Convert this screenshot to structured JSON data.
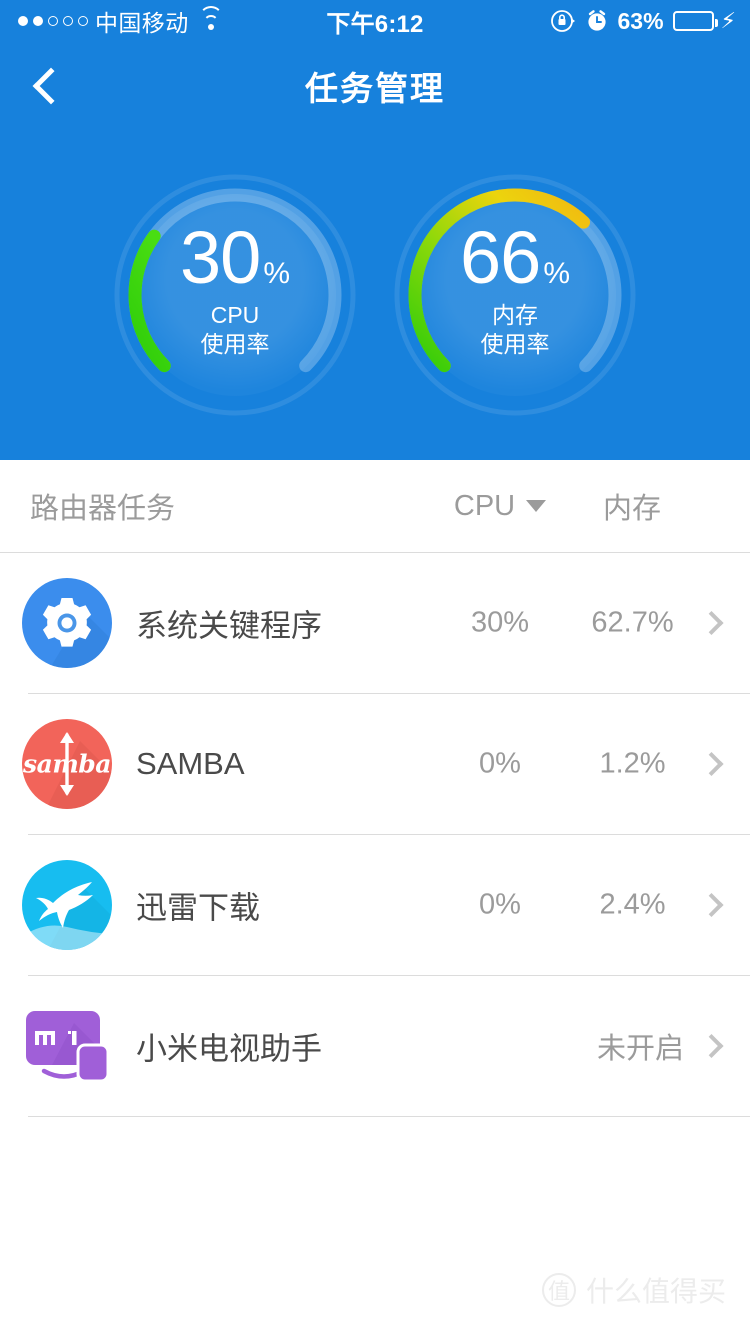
{
  "statusbar": {
    "signal_dots_filled": 2,
    "signal_dots_total": 5,
    "carrier": "中国移动",
    "wifi_icon": "wifi-icon",
    "time": "下午6:12",
    "rotation_lock_icon": "rotation-lock-icon",
    "alarm_icon": "alarm-clock-icon",
    "battery_percent": "63%",
    "battery_level": 63,
    "charging_icon": "lightning-bolt-icon"
  },
  "navbar": {
    "back_icon": "chevron-left-icon",
    "title": "任务管理"
  },
  "gauges": [
    {
      "key": "cpu",
      "value": "30",
      "unit": "%",
      "percent": 30,
      "label_line1": "CPU",
      "label_line2": "使用率",
      "arc_color_start": "#3ad40a",
      "arc_color_end": "#2ecc0a"
    },
    {
      "key": "memory",
      "value": "66",
      "unit": "%",
      "percent": 66,
      "label_line1": "内存",
      "label_line2": "使用率",
      "arc_color_start": "#2ecc0a",
      "arc_color_end": "#f2c312"
    }
  ],
  "list": {
    "header": {
      "name": "路由器任务",
      "cpu": "CPU",
      "cpu_sort_icon": "caret-down-icon",
      "memory": "内存"
    },
    "rows": [
      {
        "icon": "gear-icon",
        "name": "系统关键程序",
        "cpu": "30%",
        "memory": "62.7%",
        "state": "",
        "chevron_icon": "chevron-right-icon"
      },
      {
        "icon": "samba-icon",
        "icon_text": "samba",
        "name": "SAMBA",
        "cpu": "0%",
        "memory": "1.2%",
        "state": "",
        "chevron_icon": "chevron-right-icon"
      },
      {
        "icon": "thunder-bird-icon",
        "name": "迅雷下载",
        "cpu": "0%",
        "memory": "2.4%",
        "state": "",
        "chevron_icon": "chevron-right-icon"
      },
      {
        "icon": "mi-tv-icon",
        "name": "小米电视助手",
        "cpu": "",
        "memory": "",
        "state": "未开启",
        "chevron_icon": "chevron-right-icon"
      }
    ]
  },
  "watermark": {
    "badge": "值",
    "text": "什么值得买"
  },
  "colors": {
    "brand_blue": "#1781dc",
    "green": "#2ecc0a",
    "amber": "#f2c312",
    "text_primary": "#4a4a4a",
    "text_muted": "#9b9b9b",
    "divider": "#dcdcdc"
  }
}
